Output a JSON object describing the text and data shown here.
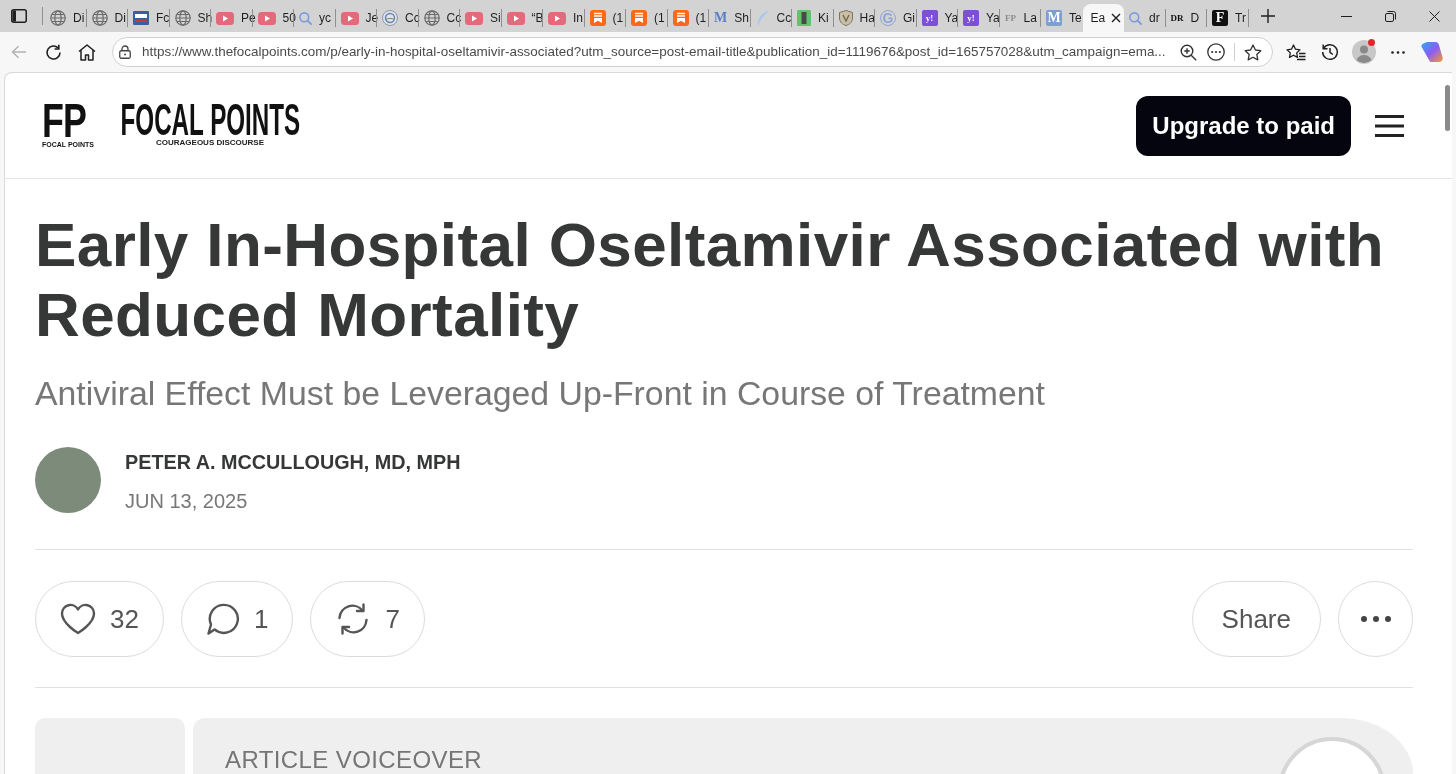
{
  "browser": {
    "tabs": [
      {
        "label": "Di",
        "kind": "globe",
        "selected": false
      },
      {
        "label": "Di",
        "kind": "globe",
        "selected": false
      },
      {
        "label": "Fc",
        "kind": "news",
        "selected": false
      },
      {
        "label": "Sh",
        "kind": "globe",
        "selected": false
      },
      {
        "label": "Pe",
        "kind": "video",
        "selected": false
      },
      {
        "label": "50",
        "kind": "video",
        "selected": false
      },
      {
        "label": "yc",
        "kind": "search",
        "selected": false
      },
      {
        "label": "Je",
        "kind": "video",
        "selected": false
      },
      {
        "label": "Cc",
        "kind": "seal",
        "selected": false
      },
      {
        "label": "Cc",
        "kind": "globe",
        "selected": false
      },
      {
        "label": "Si",
        "kind": "video",
        "selected": false
      },
      {
        "label": "“B",
        "kind": "video",
        "selected": false
      },
      {
        "label": "In",
        "kind": "video",
        "selected": false
      },
      {
        "label": "(1",
        "kind": "bookmark",
        "selected": false
      },
      {
        "label": "(1",
        "kind": "bookmark",
        "selected": false
      },
      {
        "label": "(1",
        "kind": "bookmark",
        "selected": false
      },
      {
        "label": "Sh",
        "kind": "letter",
        "glyph": "M",
        "color": "#5b7fc4",
        "selected": false
      },
      {
        "label": "Cc",
        "kind": "feather",
        "selected": false
      },
      {
        "label": "Ki",
        "kind": "bar-tile",
        "selected": false
      },
      {
        "label": "Ha",
        "kind": "shield",
        "selected": false
      },
      {
        "label": "Gi",
        "kind": "letter-ring",
        "glyph": "G",
        "color": "#8ea6d6",
        "selected": false
      },
      {
        "label": "Ya",
        "kind": "letter-tile",
        "glyph": "y!",
        "color": "#7d4fd6",
        "selected": false
      },
      {
        "label": "Ya",
        "kind": "letter-tile",
        "glyph": "y!",
        "color": "#7d4fd6",
        "selected": false
      },
      {
        "label": "La",
        "kind": "letter",
        "glyph": "FP",
        "color": "#8c8c8c",
        "selected": false
      },
      {
        "label": "Te",
        "kind": "letter-tile",
        "glyph": "M",
        "color": "#7b9fd0",
        "selected": false
      },
      {
        "label": "Ea",
        "selected": true
      },
      {
        "label": "dr",
        "kind": "search",
        "selected": false
      },
      {
        "label": "D",
        "kind": "letter",
        "glyph": "DR",
        "color": "#111111",
        "selected": false
      },
      {
        "label": "Tr",
        "kind": "letter-tile",
        "glyph": "F",
        "color": "#111111",
        "selected": false
      }
    ],
    "navigation": {
      "back_disabled": true
    },
    "address_bar": {
      "url": "https://www.thefocalpoints.com/p/early-in-hospital-oseltamivir-associated?utm_source=post-email-title&publication_id=1119676&post_id=165757028&utm_campaign=ema..."
    },
    "profile": {
      "notification": true
    }
  },
  "header": {
    "logo_mark": "FP",
    "logo_caption": "FOCAL POINTS",
    "wordmark": "FOCAL POINTS",
    "tagline": "COURAGEOUS DISCOURSE",
    "upgrade_button": "Upgrade to paid"
  },
  "article": {
    "title": "Early In-Hospital Oseltamivir Associated with Reduced Mortality",
    "subtitle": "Antiviral Effect Must be Leveraged Up-Front in Course of Treatment",
    "author": {
      "name": "PETER A. MCCULLOUGH, MD, MPH",
      "date": "JUN 13, 2025"
    },
    "actions": [
      {
        "kind": "like",
        "count": "32"
      },
      {
        "kind": "comment",
        "count": "1"
      },
      {
        "kind": "restack",
        "count": "7"
      }
    ],
    "share_button": "Share",
    "voiceover": {
      "label": "ARTICLE VOICEOVER"
    }
  }
}
